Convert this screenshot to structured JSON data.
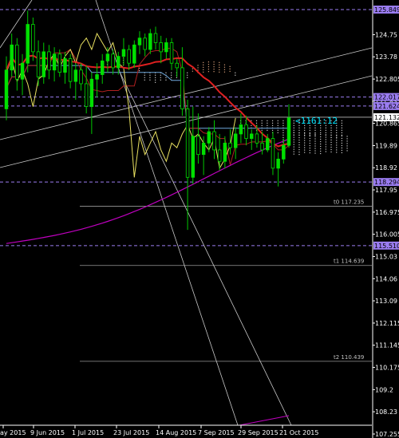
{
  "chart_data": {
    "type": "candlestick",
    "instrument": "USDJPY",
    "timeframe": "D1",
    "y_range": [
      107.2,
      125.9
    ],
    "y_ticks": [
      124.75,
      123.78,
      122.805,
      121.835,
      120.865,
      119.89,
      118.92,
      117.95,
      116.975,
      116.005,
      115.03,
      114.06,
      113.09,
      112.115,
      111.145,
      110.175,
      109.2,
      108.23,
      107.255
    ],
    "x_labels": [
      "ay 2015",
      "9 Jun 2015",
      "1 Jul 2015",
      "23 Jul 2015",
      "14 Aug 2015",
      "7 Sep 2015",
      "29 Sep 2015",
      "21 Oct 2015"
    ],
    "price_badges": [
      {
        "value": "125.849",
        "price": 125.849,
        "color": "#9a7cf0",
        "text_color": "#000000"
      },
      {
        "value": "122.017",
        "price": 122.017,
        "color": "#9a7cf0",
        "text_color": "#000000"
      },
      {
        "value": "121.624",
        "price": 121.624,
        "color": "#9a7cf0",
        "text_color": "#000000"
      },
      {
        "value": "121.132",
        "price": 121.132,
        "color": "#ffffff",
        "text_color": "#000000"
      },
      {
        "value": "118.294",
        "price": 118.294,
        "color": "#9a7cf0",
        "text_color": "#000000"
      },
      {
        "value": "115.510",
        "price": 115.51,
        "color": "#9a7cf0",
        "text_color": "#000000"
      }
    ],
    "horizontal_levels": [
      {
        "label": "t0 117.235",
        "price": 117.235
      },
      {
        "label": "t1 114.639",
        "price": 114.639
      },
      {
        "label": "t2 110.439",
        "price": 110.439
      }
    ],
    "timer": "<1161:12",
    "candles": [
      [
        121.5,
        123.8,
        121.0,
        123.2
      ],
      [
        123.2,
        124.8,
        122.9,
        124.3
      ],
      [
        124.3,
        124.6,
        122.3,
        122.8
      ],
      [
        122.8,
        123.9,
        122.1,
        123.5
      ],
      [
        123.5,
        125.8,
        123.1,
        125.2
      ],
      [
        125.2,
        125.5,
        123.6,
        124.0
      ],
      [
        124.0,
        124.5,
        122.5,
        122.9
      ],
      [
        122.9,
        124.4,
        122.6,
        124.0
      ],
      [
        124.0,
        124.3,
        122.8,
        123.2
      ],
      [
        123.2,
        124.2,
        122.7,
        123.9
      ],
      [
        123.9,
        124.1,
        122.9,
        123.1
      ],
      [
        123.1,
        124.0,
        122.6,
        123.7
      ],
      [
        123.7,
        123.9,
        122.4,
        122.7
      ],
      [
        122.7,
        123.5,
        121.9,
        123.2
      ],
      [
        123.2,
        123.5,
        122.3,
        122.6
      ],
      [
        122.6,
        123.4,
        121.3,
        121.6
      ],
      [
        121.6,
        123.1,
        120.4,
        122.8
      ],
      [
        122.8,
        123.5,
        122.0,
        123.0
      ],
      [
        123.0,
        123.9,
        122.6,
        123.6
      ],
      [
        123.6,
        124.2,
        123.1,
        123.9
      ],
      [
        123.9,
        124.1,
        123.0,
        123.3
      ],
      [
        123.3,
        124.0,
        123.0,
        123.8
      ],
      [
        123.8,
        124.6,
        123.4,
        124.1
      ],
      [
        124.1,
        124.3,
        123.2,
        123.5
      ],
      [
        123.5,
        124.5,
        123.3,
        124.3
      ],
      [
        124.3,
        124.9,
        123.9,
        124.6
      ],
      [
        124.6,
        124.8,
        123.8,
        124.1
      ],
      [
        124.1,
        125.0,
        123.9,
        124.8
      ],
      [
        124.8,
        125.1,
        124.1,
        124.4
      ],
      [
        124.4,
        124.7,
        123.5,
        124.0
      ],
      [
        124.0,
        124.6,
        123.7,
        124.4
      ],
      [
        124.4,
        124.6,
        123.2,
        123.5
      ],
      [
        123.5,
        123.7,
        122.9,
        123.3
      ],
      [
        123.3,
        124.2,
        121.2,
        121.5
      ],
      [
        121.5,
        121.9,
        116.2,
        118.5
      ],
      [
        118.5,
        121.6,
        118.2,
        120.3
      ],
      [
        120.3,
        121.3,
        119.1,
        119.5
      ],
      [
        119.5,
        120.3,
        118.6,
        120.0
      ],
      [
        120.0,
        120.7,
        119.6,
        120.5
      ],
      [
        120.5,
        121.0,
        119.3,
        119.7
      ],
      [
        119.7,
        120.4,
        118.8,
        119.2
      ],
      [
        119.2,
        120.3,
        118.9,
        120.0
      ],
      [
        120.0,
        120.6,
        119.5,
        119.8
      ],
      [
        119.8,
        120.7,
        119.3,
        120.4
      ],
      [
        120.4,
        121.3,
        120.0,
        120.8
      ],
      [
        120.8,
        121.2,
        119.9,
        120.2
      ],
      [
        120.2,
        120.6,
        119.7,
        120.4
      ],
      [
        120.4,
        120.8,
        119.8,
        120.0
      ],
      [
        120.0,
        120.5,
        119.5,
        119.7
      ],
      [
        119.7,
        120.4,
        119.6,
        120.2
      ],
      [
        120.2,
        120.5,
        118.6,
        118.9
      ],
      [
        118.9,
        119.6,
        118.1,
        119.3
      ],
      [
        119.3,
        120.2,
        119.1,
        119.9
      ],
      [
        119.9,
        121.7,
        119.8,
        121.1
      ]
    ]
  }
}
